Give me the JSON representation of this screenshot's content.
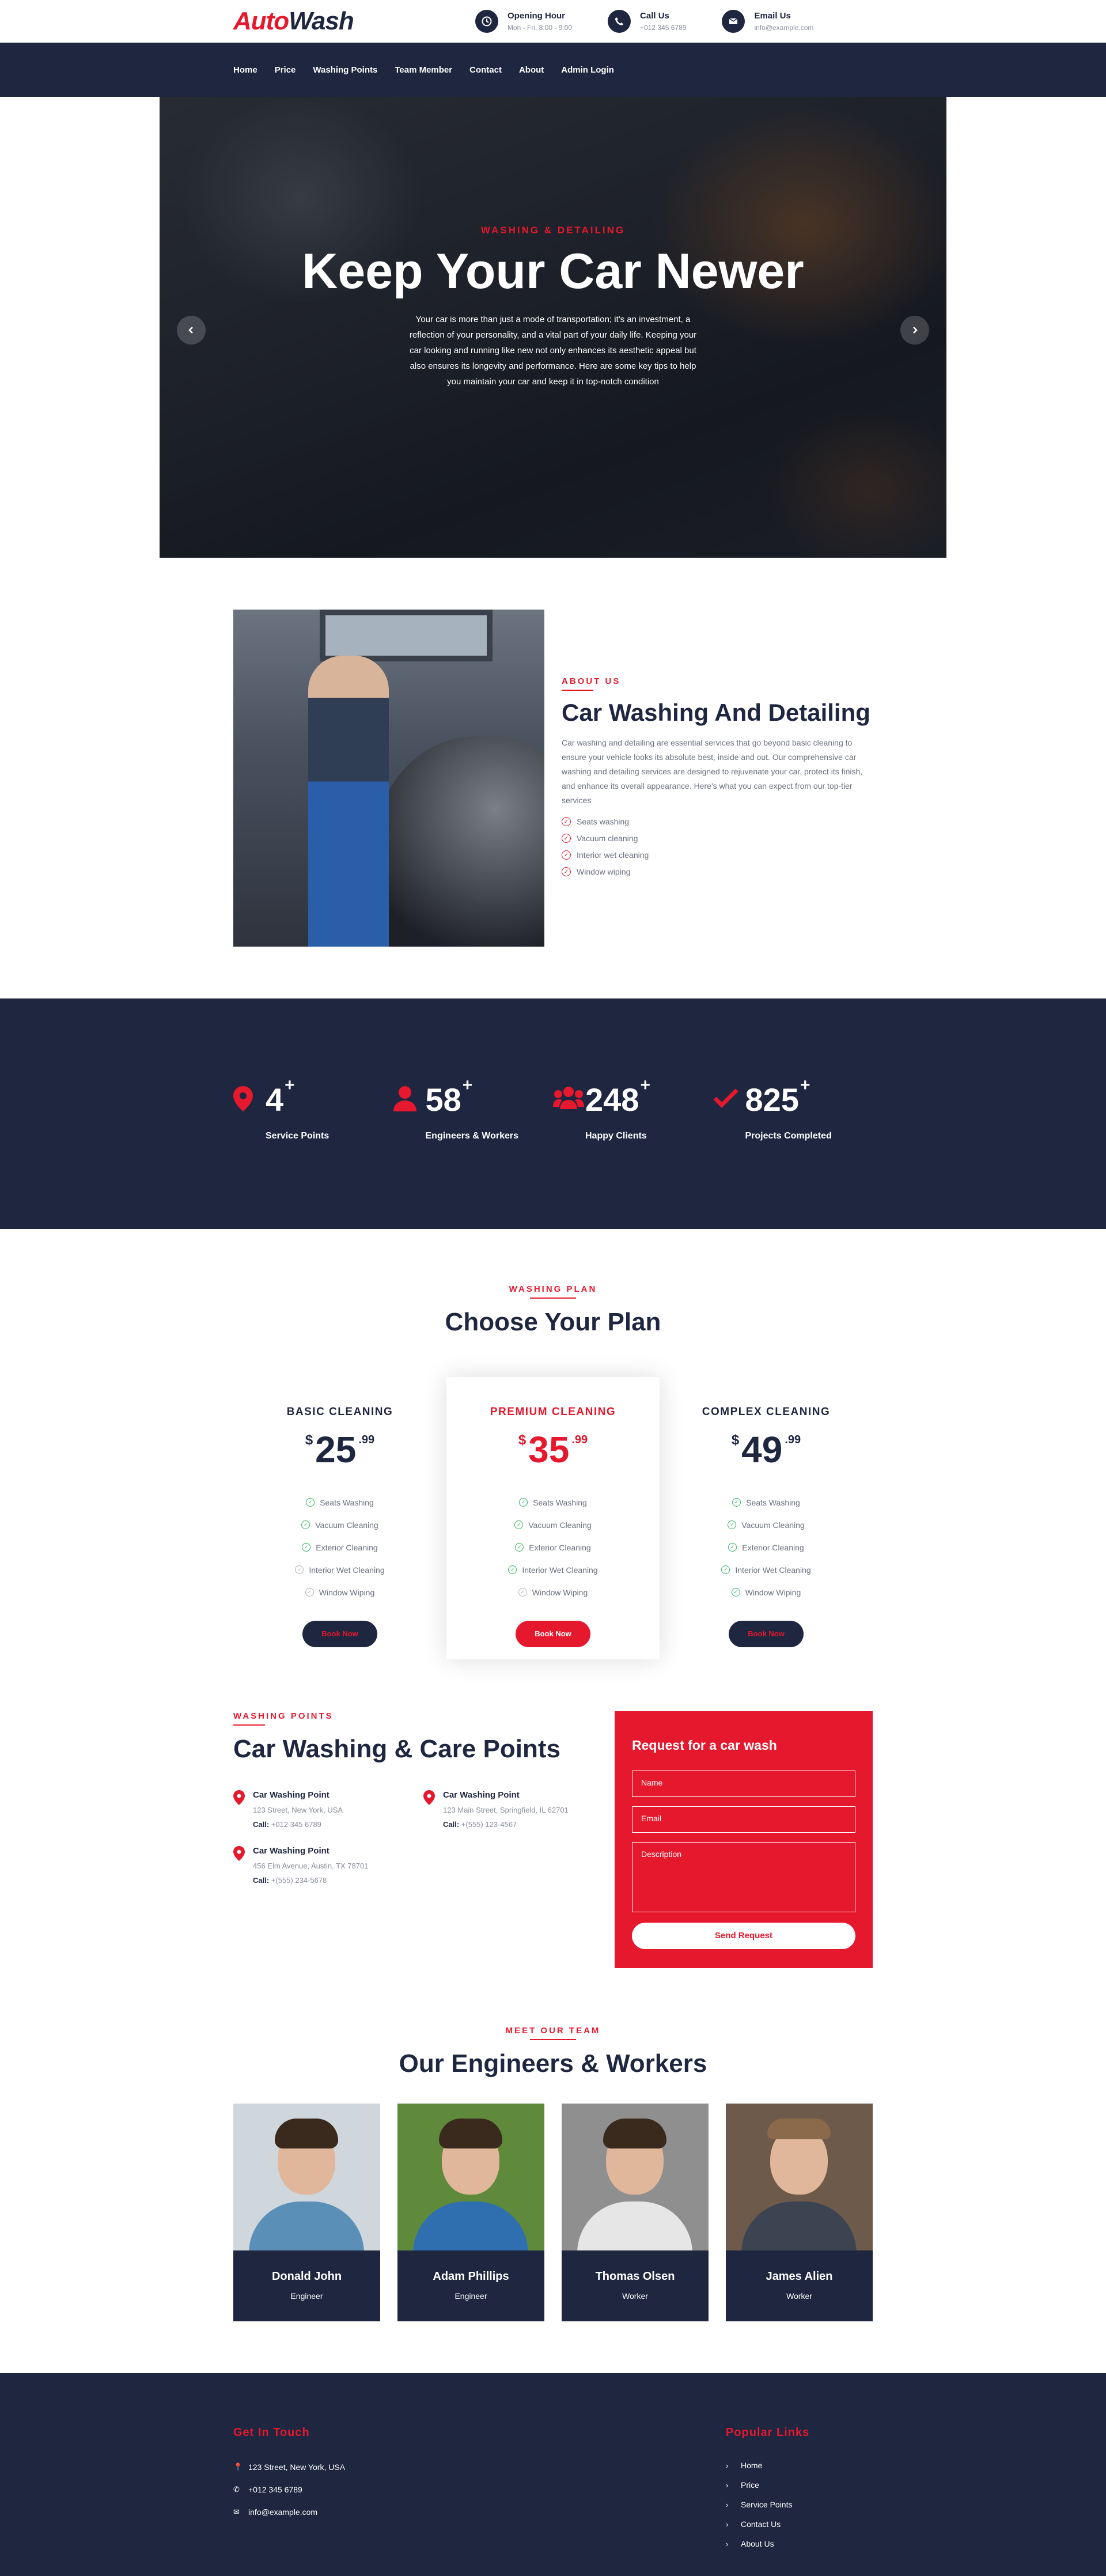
{
  "brand": {
    "part1": "Auto",
    "part2": "Wash"
  },
  "header_info": [
    {
      "icon": "clock-icon",
      "title": "Opening Hour",
      "sub": "Mon - Fri, 8:00 - 9:00"
    },
    {
      "icon": "phone-icon",
      "title": "Call Us",
      "sub": "+012 345 6789"
    },
    {
      "icon": "envelope-icon",
      "title": "Email Us",
      "sub": "info@example.com"
    }
  ],
  "nav": [
    "Home",
    "Price",
    "Washing Points",
    "Team Member",
    "Contact",
    "About",
    "Admin Login"
  ],
  "hero": {
    "kicker": "WASHING & DETAILING",
    "title": "Keep Your Car Newer",
    "text": "Your car is more than just a mode of transportation; it's an investment, a reflection of your personality, and a vital part of your daily life. Keeping your car looking and running like new not only enhances its aesthetic appeal but also ensures its longevity and performance. Here are some key tips to help you maintain your car and keep it in top-notch condition"
  },
  "about": {
    "kicker": "ABOUT US",
    "title": "Car Washing And Detailing",
    "text": "Car washing and detailing are essential services that go beyond basic cleaning to ensure your vehicle looks its absolute best, inside and out. Our comprehensive car washing and detailing services are designed to rejuvenate your car, protect its finish, and enhance its overall appearance. Here's what you can expect from our top-tier services",
    "items": [
      "Seats washing",
      "Vacuum cleaning",
      "Interior wet cleaning",
      "Window wiping"
    ]
  },
  "stats": [
    {
      "icon": "map-pin-icon",
      "value": "4",
      "label": "Service Points"
    },
    {
      "icon": "user-icon",
      "value": "58",
      "label": "Engineers & Workers"
    },
    {
      "icon": "users-icon",
      "value": "248",
      "label": "Happy Clients"
    },
    {
      "icon": "check-icon",
      "value": "825",
      "label": "Projects Completed"
    }
  ],
  "pricing": {
    "kicker": "WASHING PLAN",
    "title": "Choose Your Plan",
    "plans": [
      {
        "name": "BASIC CLEANING",
        "currency": "$",
        "amount": "25",
        "cents": ".99",
        "features": [
          {
            "text": "Seats Washing",
            "on": true
          },
          {
            "text": "Vacuum Cleaning",
            "on": true
          },
          {
            "text": "Exterior Cleaning",
            "on": true
          },
          {
            "text": "Interior Wet Cleaning",
            "on": false
          },
          {
            "text": "Window Wiping",
            "on": false
          }
        ],
        "button": "Book Now"
      },
      {
        "name": "PREMIUM CLEANING",
        "currency": "$",
        "amount": "35",
        "cents": ".99",
        "features": [
          {
            "text": "Seats Washing",
            "on": true
          },
          {
            "text": "Vacuum Cleaning",
            "on": true
          },
          {
            "text": "Exterior Cleaning",
            "on": true
          },
          {
            "text": "Interior Wet Cleaning",
            "on": true
          },
          {
            "text": "Window Wiping",
            "on": false
          }
        ],
        "button": "Book Now"
      },
      {
        "name": "COMPLEX CLEANING",
        "currency": "$",
        "amount": "49",
        "cents": ".99",
        "features": [
          {
            "text": "Seats Washing",
            "on": true
          },
          {
            "text": "Vacuum Cleaning",
            "on": true
          },
          {
            "text": "Exterior Cleaning",
            "on": true
          },
          {
            "text": "Interior Wet Cleaning",
            "on": true
          },
          {
            "text": "Window Wiping",
            "on": true
          }
        ],
        "button": "Book Now"
      }
    ]
  },
  "points": {
    "kicker": "WASHING POINTS",
    "title": "Car Washing & Care Points",
    "call_label": "Call:",
    "items": [
      {
        "name": "Car Washing Point",
        "address": "123 Street, New York, USA",
        "phone": "+012 345 6789"
      },
      {
        "name": "Car Washing Point",
        "address": "123 Main Street, Springfield, IL 62701",
        "phone": "+(555) 123-4567"
      },
      {
        "name": "Car Washing Point",
        "address": "456 Elm Avenue, Austin, TX 78701",
        "phone": "+(555) 234-5678"
      }
    ]
  },
  "request": {
    "title": "Request for a car wash",
    "name_placeholder": "Name",
    "email_placeholder": "Email",
    "desc_placeholder": "Description",
    "button": "Send Request"
  },
  "team": {
    "kicker": "MEET OUR TEAM",
    "title": "Our Engineers & Workers",
    "members": [
      {
        "name": "Donald John",
        "role": "Engineer",
        "bg": "#cfd6dc",
        "shirt": "#5a8fb8"
      },
      {
        "name": "Adam Phillips",
        "role": "Engineer",
        "bg": "#5f8a3c",
        "shirt": "#2f6fb0"
      },
      {
        "name": "Thomas Olsen",
        "role": "Worker",
        "bg": "#8f8f8f",
        "shirt": "#e6e6e6"
      },
      {
        "name": "James Alien",
        "role": "Worker",
        "bg": "#6e5a4a",
        "shirt": "#3b4450"
      }
    ]
  },
  "footer": {
    "contact_title": "Get In Touch",
    "contact": [
      {
        "icon": "map-pin-icon",
        "text": "123 Street, New York, USA"
      },
      {
        "icon": "phone-icon",
        "text": "+012 345 6789"
      },
      {
        "icon": "envelope-icon",
        "text": "info@example.com"
      }
    ],
    "links_title": "Popular Links",
    "links": [
      "Home",
      "Price",
      "Service Points",
      "Contact Us",
      "About Us"
    ]
  },
  "colors": {
    "primary": "#e5182d",
    "dark": "#1e2640"
  }
}
